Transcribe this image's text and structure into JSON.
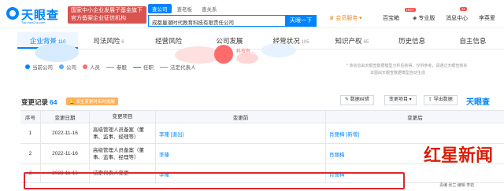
{
  "header": {
    "logo_text": "天眼查",
    "logo_sub": "TianYanCha.com",
    "banner_line1": "国家中小企业发展子基金旗下",
    "banner_line2": "官方备案企业征信机构",
    "search_tabs": [
      "查公司",
      "查老板",
      "查关系"
    ],
    "search_value": "成都量潮时代教育科技有限责任公司",
    "search_button": "天眼一下",
    "member_service": "会员服务",
    "toolbox": "百宝箱",
    "pro": "专业版",
    "messages": "消息中心",
    "messages_count": "11",
    "user_name": "李英爱",
    "hot_badge": "HOT",
    "colors": {
      "brand": "#0084ff",
      "alert": "#e0262c",
      "orange": "#f08519"
    }
  },
  "tabs": [
    {
      "label": "企业背景",
      "count": "110"
    },
    {
      "label": "司法风险",
      "count": "6"
    },
    {
      "label": "经营风险",
      "count": ""
    },
    {
      "label": "公司发展",
      "count": ""
    },
    {
      "label": "经营状况",
      "count": "105"
    },
    {
      "label": "知识产权",
      "count": "65"
    },
    {
      "label": "历史信息",
      "count": ""
    },
    {
      "label": "自主信息",
      "count": ""
    }
  ],
  "graph": {
    "bubble_label": "科技有...",
    "legend": [
      "当前公司",
      "公司",
      "人员",
      "参股",
      "任职",
      "法定代表人"
    ],
    "tip": "* 该信息由天眼查数据模型分析后获得，仅供参考，请通过天眼查核实",
    "tip2": "本图由天眼查数据模型自动生成"
  },
  "change_log": {
    "title": "变更记录",
    "count": "64",
    "note": "发生变更时实时提醒",
    "buttons": [
      "数据纠错",
      "变更项目 ▾",
      "导出数据"
    ],
    "brand": "天眼查",
    "columns": [
      "序号",
      "变更日期",
      "变更项目",
      "变更前",
      "变更后"
    ],
    "rows": [
      {
        "seq": "1",
        "date": "2022-11-16",
        "item": "高级管理人员备案（董事、监事、经理等）",
        "before": "李隆 [退出]",
        "after": "肖丽梅 [新增]"
      },
      {
        "seq": "2",
        "date": "2022-11-16",
        "item": "高级管理人员备案（董事、监事、经理等）",
        "before": "李隆",
        "after": "肖丽梅"
      },
      {
        "seq": "3",
        "date": "2022-11-16",
        "item": "法定代表人变更",
        "before": "李隆",
        "after": "肖丽梅"
      }
    ]
  },
  "watermark": {
    "title": "红星新闻",
    "sub": "责编 张兰 编辑 李岩"
  }
}
